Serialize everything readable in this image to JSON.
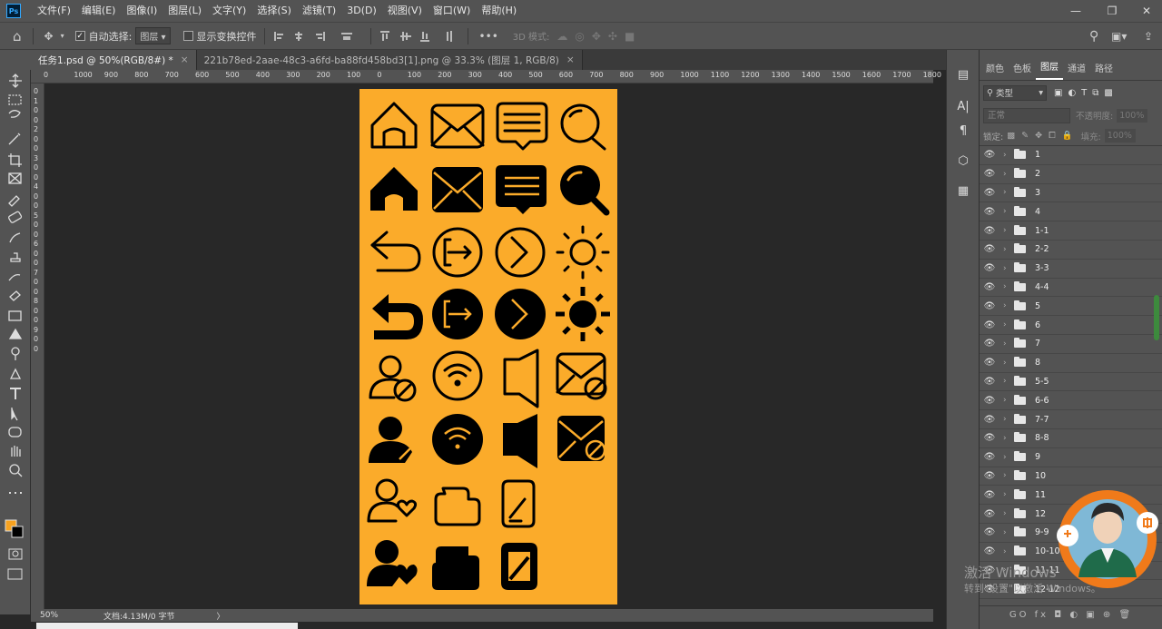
{
  "menubar": {
    "logo": "Ps",
    "items": [
      "文件(F)",
      "编辑(E)",
      "图像(I)",
      "图层(L)",
      "文字(Y)",
      "选择(S)",
      "滤镜(T)",
      "3D(D)",
      "视图(V)",
      "窗口(W)",
      "帮助(H)"
    ],
    "win_min": "—",
    "win_max": "❐",
    "win_close": "✕"
  },
  "options": {
    "auto_select_label": "自动选择:",
    "auto_select_value": "图层",
    "show_transform": "显示变换控件",
    "more": "•••",
    "mode_3d": "3D 模式:"
  },
  "tabs": [
    {
      "label": "任务1.psd @ 50%(RGB/8#) *",
      "close": "×",
      "active": true
    },
    {
      "label": "221b78ed-2aae-48c3-a6fd-ba88fd458bd3[1].png @ 33.3% (图层 1, RGB/8)",
      "close": "×",
      "active": false
    }
  ],
  "ruler": {
    "ticks": [
      "0",
      "1000",
      "900",
      "800",
      "700",
      "600",
      "500",
      "400",
      "300",
      "200",
      "100",
      "0",
      "100",
      "200",
      "300",
      "400",
      "500",
      "600",
      "700",
      "800",
      "900",
      "1000",
      "1100",
      "1200",
      "1300",
      "1400",
      "1500",
      "1600",
      "1700",
      "1800"
    ]
  },
  "ruler_left": {
    "ticks": [
      "0",
      "1",
      "0",
      "0",
      "2",
      "0",
      "0",
      "3",
      "0",
      "0",
      "4",
      "0",
      "0",
      "5",
      "0",
      "0",
      "6",
      "0",
      "0",
      "7",
      "0",
      "0",
      "8",
      "0",
      "0",
      "9",
      "0",
      "0"
    ]
  },
  "status": {
    "zoom": "50%",
    "doc": "文档:4.13M/0 字节",
    "arrow": "〉"
  },
  "panel": {
    "tabs": [
      "颜色",
      "色板",
      "图层",
      "通道",
      "路径"
    ],
    "active_tab": "图层",
    "filter_label": "类型",
    "blend": "正常",
    "opacity_label": "不透明度:",
    "opacity_value": "100%",
    "lock_label": "锁定:",
    "fill_label": "填充:",
    "fill_value": "100%",
    "footer_icons": "GO  fx  ◘  ◐  ▣  ⊕  🗑"
  },
  "layers": [
    "1",
    "2",
    "3",
    "4",
    "1-1",
    "2-2",
    "3-3",
    "4-4",
    "5",
    "6",
    "7",
    "8",
    "5-5",
    "6-6",
    "7-7",
    "8-8",
    "9",
    "10",
    "11",
    "12",
    "9-9",
    "10-10",
    "11-11",
    "12-12"
  ],
  "watermark": {
    "line1": "激活 Windows",
    "line2": "转到\"设置\"以激活 Windows。"
  },
  "colors": {
    "canvas": "#fbab2a",
    "foreground": "#f7a21f",
    "background": "#000000"
  }
}
